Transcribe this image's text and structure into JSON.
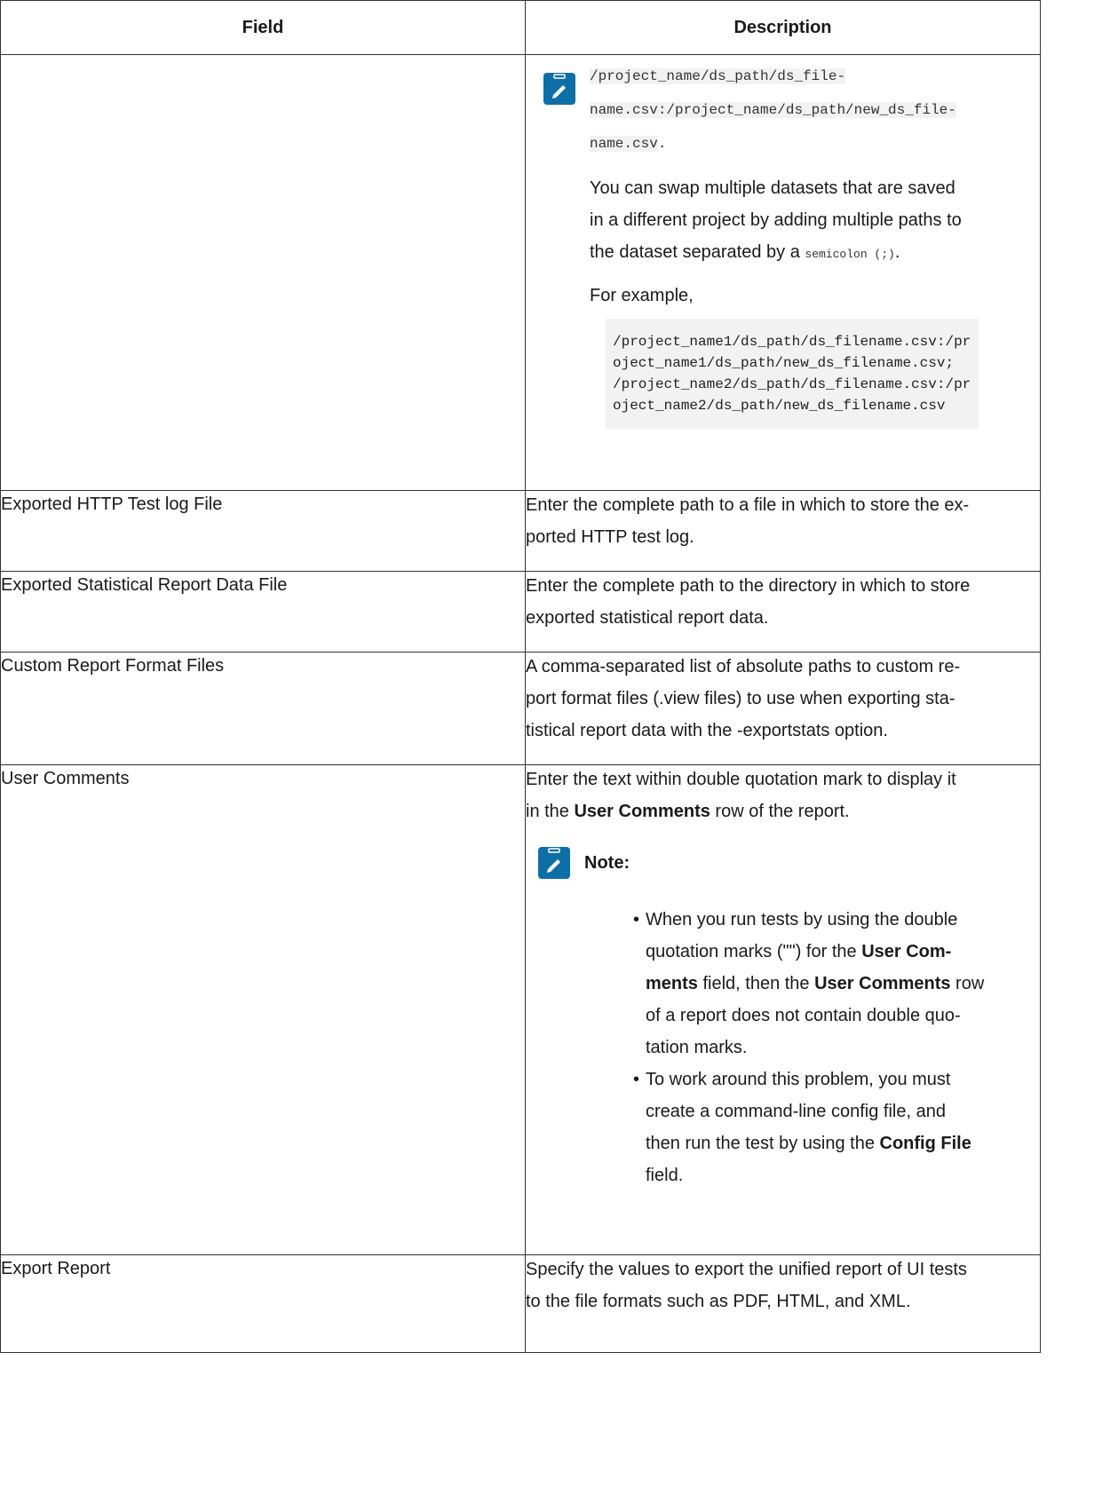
{
  "headers": {
    "field": "Field",
    "description": "Description"
  },
  "row0": {
    "path_line1": "/project_name/ds_path/ds_file-",
    "path_line2": "name.csv:/project_name/ds_path/new_ds_file-",
    "path_line3": "name.csv",
    "path_end": ".",
    "swap_text_1": "You can swap multiple datasets that are saved",
    "swap_text_2": "in a different project by adding multiple paths to",
    "swap_text_3": "the dataset separated by a",
    "swap_code": "semicolon (;)",
    "swap_end": ".",
    "example_label": "For example,",
    "code_lines": [
      "/project_name1/ds_path/ds_filename.csv:/pr",
      "oject_name1/ds_path/new_ds_filename.csv;",
      "/project_name2/ds_path/ds_filename.csv:/pr",
      "oject_name2/ds_path/new_ds_filename.csv"
    ]
  },
  "rows": [
    {
      "field": "Exported HTTP Test log File",
      "desc": [
        "Enter the complete path to a file in which to store the ex-",
        "ported HTTP test log."
      ]
    },
    {
      "field": "Exported Statistical Report Data File",
      "desc": [
        "Enter the complete path to the directory in which to store",
        "exported statistical report data."
      ]
    },
    {
      "field": "Custom Report Format Files",
      "desc": [
        "A comma-separated list of absolute paths to custom re-",
        "port format files (.view files) to use when exporting sta-",
        "tistical report data with the -exportstats option."
      ]
    }
  ],
  "user_comments": {
    "field": "User Comments",
    "line1": "Enter the text within double quotation mark to display it",
    "line2_a": "in the ",
    "line2_b": "User Comments",
    "line2_c": " row of the report.",
    "note_label": "Note:",
    "b1_l1": "When you run tests by using the double",
    "b1_l2_a": "quotation marks (\"\") for the ",
    "b1_l2_b": "User Com-",
    "b1_l3_a": "ments",
    "b1_l3_b": " field, then the ",
    "b1_l3_c": "User Comments",
    "b1_l3_d": " row",
    "b1_l4": "of a report does not contain double quo-",
    "b1_l5": "tation marks.",
    "b2_l1": "To work around this problem, you must",
    "b2_l2": "create a command-line config file, and",
    "b2_l3_a": "then run the test by using the ",
    "b2_l3_b": "Config File",
    "b2_l4": "field."
  },
  "export_report": {
    "field": "Export Report",
    "desc": [
      "Specify the values to export the unified report of UI tests",
      "to the file formats such as PDF, HTML, and XML."
    ]
  }
}
